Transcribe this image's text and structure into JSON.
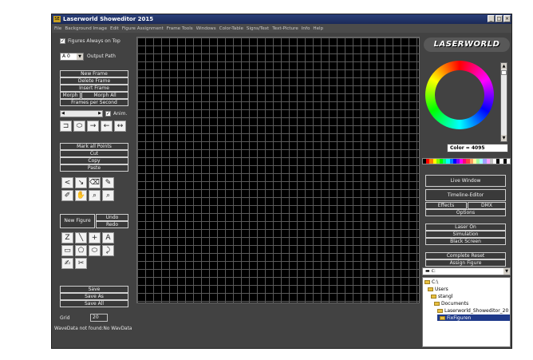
{
  "window": {
    "title": "Laserworld Showeditor 2015",
    "icon": "app-icon",
    "controls": [
      "_",
      "□",
      "×"
    ]
  },
  "menu": [
    "File",
    "Background Image",
    "Edit",
    "Figure Assignment",
    "Frame Tools",
    "Windows",
    "Color-Table",
    "Signs/Text",
    "Text-Picture",
    "Info",
    "Help"
  ],
  "left": {
    "figures_always_on_top": "Figures Always on Top",
    "output_select": "A 0",
    "output_path": "Output Path",
    "frame_buttons": {
      "new_frame": "New Frame",
      "delete_frame": "Delete Frame",
      "insert_frame": "Insert Frame",
      "morph": "Morph",
      "morph_all": "Morph All",
      "fps": "Frames per Second"
    },
    "anim": "Anim.",
    "point_buttons": {
      "mark_all": "Mark all Points",
      "cut": "Cut",
      "copy": "Copy",
      "paste": "Paste"
    },
    "figure": {
      "new_figure": "New Figure",
      "undo": "Undo",
      "redo": "Redo"
    },
    "save": {
      "save": "Save",
      "save_as": "Save As",
      "save_all": "Save All"
    },
    "grid_label": "Grid",
    "grid_value": "20",
    "status": "WaveData not found:No WavData"
  },
  "right": {
    "logo": "LASERWORLD",
    "color_value": "Color = 4095",
    "palette": [
      "#000000",
      "#ff0000",
      "#ff8000",
      "#ffff00",
      "#80ff00",
      "#00ff00",
      "#00ff80",
      "#00ffff",
      "#0080ff",
      "#0000ff",
      "#8000ff",
      "#ff00ff",
      "#ff0080",
      "#ff4040",
      "#ffa060",
      "#ffffa0",
      "#a0ffa0",
      "#a0ffff",
      "#a0a0ff",
      "#ffa0ff",
      "#c0c0c0",
      "#ffffff",
      "#000000",
      "#ffffff",
      "#000000",
      "#ffffff"
    ],
    "buttons": {
      "live_window": "Live Window",
      "timeline_editor": "Timeline-Editor",
      "effects": "Effects",
      "dmx": "DMX",
      "options": "Options",
      "laser_on": "Laser On",
      "simulation": "Simulation",
      "black_screen": "Black Screen",
      "complete_reset": "Complete Reset",
      "assign_figure": "Assign Figure"
    },
    "drive": "c:",
    "tree": [
      "C:\\",
      "Users",
      "stangl",
      "Documents",
      "Laserworld_Showeditor_20",
      "FixFiguren"
    ]
  }
}
